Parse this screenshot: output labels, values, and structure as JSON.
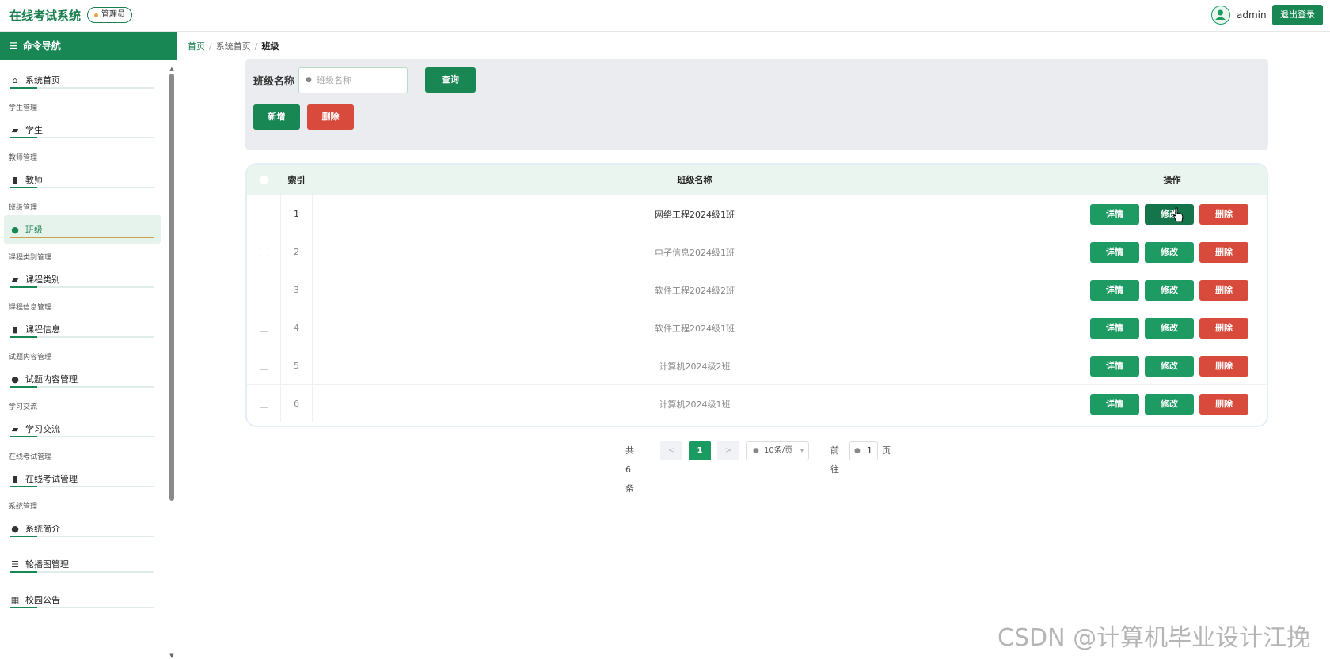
{
  "header": {
    "app_title": "在线考试系统",
    "role_badge": "管理员",
    "username": "admin",
    "logout_label": "退出登录"
  },
  "sidebar": {
    "title": "命令导航",
    "sections": [
      {
        "group": "",
        "label": "系统首页",
        "icon": "home-icon",
        "active": false
      },
      {
        "group": "学生管理",
        "label": "学生",
        "icon": "briefcase-icon",
        "active": false
      },
      {
        "group": "教师管理",
        "label": "教师",
        "icon": "bar-chart-icon",
        "active": false
      },
      {
        "group": "班级管理",
        "label": "班级",
        "icon": "location-pin-icon",
        "active": true
      },
      {
        "group": "课程类别管理",
        "label": "课程类别",
        "icon": "briefcase-icon",
        "active": false
      },
      {
        "group": "课程信息管理",
        "label": "课程信息",
        "icon": "bar-chart-icon",
        "active": false
      },
      {
        "group": "试题内容管理",
        "label": "试题内容管理",
        "icon": "location-pin-icon",
        "active": false
      },
      {
        "group": "学习交流",
        "label": "学习交流",
        "icon": "briefcase-icon",
        "active": false
      },
      {
        "group": "在线考试管理",
        "label": "在线考试管理",
        "icon": "bar-chart-icon",
        "active": false
      },
      {
        "group": "系统管理",
        "label": "系统简介",
        "icon": "location-pin-icon",
        "active": false
      },
      {
        "group": "",
        "label": "轮播图管理",
        "icon": "sliders-icon",
        "active": false
      },
      {
        "group": "",
        "label": "校园公告",
        "icon": "grid-icon",
        "active": false
      }
    ]
  },
  "breadcrumb": [
    "首页",
    "系统首页",
    "班级"
  ],
  "search": {
    "label": "班级名称",
    "placeholder": "班级名称",
    "query_label": "查询",
    "add_label": "新增",
    "delete_label": "删除"
  },
  "table": {
    "columns": [
      "索引",
      "班级名称",
      "操作"
    ],
    "rows": [
      {
        "index": "1",
        "name": "网络工程2024级1班"
      },
      {
        "index": "2",
        "name": "电子信息2024级1班"
      },
      {
        "index": "3",
        "name": "软件工程2024级2班"
      },
      {
        "index": "4",
        "name": "软件工程2024级1班"
      },
      {
        "index": "5",
        "name": "计算机2024级2班"
      },
      {
        "index": "6",
        "name": "计算机2024级1班"
      }
    ],
    "op_labels": {
      "detail": "详情",
      "edit": "修改",
      "delete": "删除"
    }
  },
  "pagination": {
    "total_text": "共 6 条",
    "prev": "<",
    "current_page": "1",
    "next": ">",
    "page_size": "10条/页",
    "goto_label": "前往",
    "goto_value": "1",
    "page_suffix": "页"
  },
  "watermark": "CSDN @计算机毕业设计江挽",
  "colors": {
    "primary": "#198754",
    "danger": "#d84a3b",
    "active_underline": "#c9a24a"
  }
}
